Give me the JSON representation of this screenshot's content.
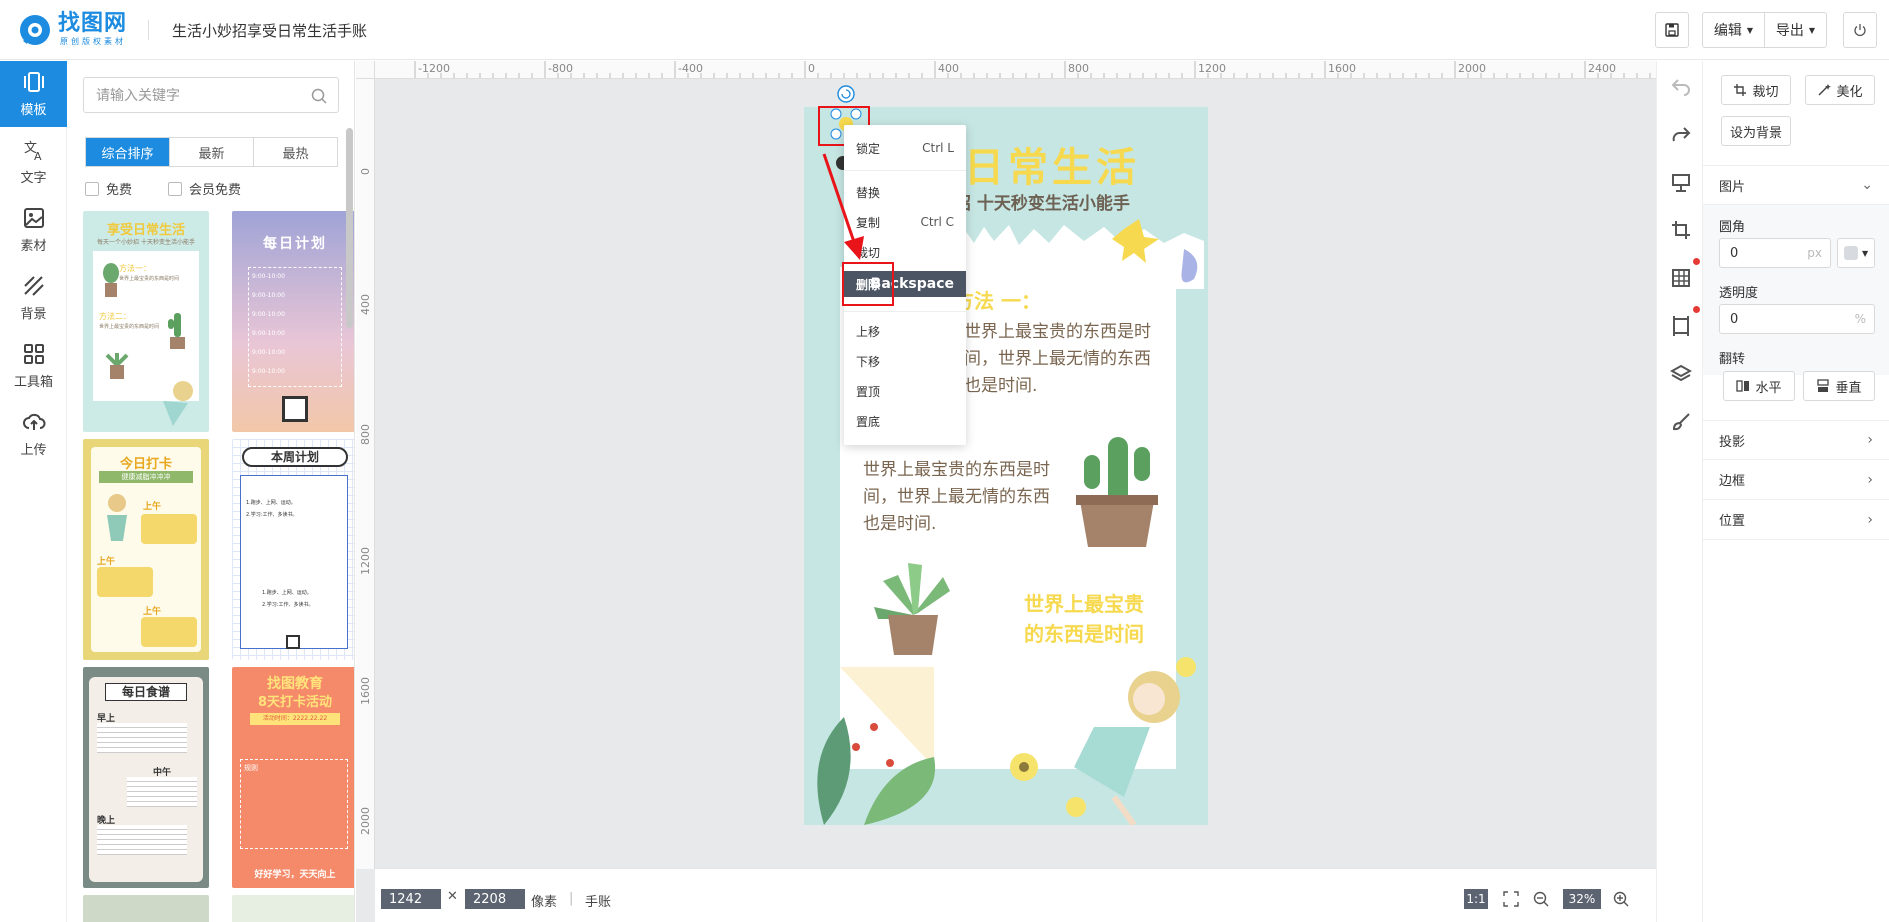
{
  "header": {
    "logo_text": "找图网",
    "logo_sub": "原创版权素材",
    "doc_title": "生活小妙招享受日常生活手账",
    "edit_label": "编辑",
    "export_label": "导出"
  },
  "rail": [
    {
      "label": "模板",
      "icon": "template-icon",
      "active": true
    },
    {
      "label": "文字",
      "icon": "text-icon"
    },
    {
      "label": "素材",
      "icon": "image-icon"
    },
    {
      "label": "背景",
      "icon": "background-icon"
    },
    {
      "label": "工具箱",
      "icon": "toolbox-icon"
    },
    {
      "label": "上传",
      "icon": "upload-icon"
    }
  ],
  "panel": {
    "search_placeholder": "请输入关键字",
    "sort_tabs": [
      "综合排序",
      "最新",
      "最热"
    ],
    "filters": [
      "免费",
      "会员免费"
    ],
    "templates": [
      {
        "title": "享受日常生活",
        "subtitle": "每天一个小妙招 十天秒变生活小能手",
        "lines": [
          "方法一：",
          "世界上最宝贵的东西是时间",
          "方法二：",
          "世界上最宝贵的东西是时间"
        ]
      },
      {
        "title": "每日计划",
        "rows": [
          "9:00-10:00",
          "9:00-10:00",
          "9:00-10:00",
          "9:00-10:00",
          "9:00-10:00",
          "9:00-10:00"
        ]
      },
      {
        "title": "今日打卡",
        "subtitle": "健康减脂冲冲冲",
        "lines": [
          "上午",
          "上午",
          "上午"
        ]
      },
      {
        "title": "本周计划",
        "lines": [
          "1.跑步、上网、运动。",
          "2.学习:工作、多读书。",
          "1.跑步、上网、运动。",
          "2.学习:工作、多读书。"
        ]
      },
      {
        "title": "每日食谱",
        "lines": [
          "早上",
          "中午",
          "晚上"
        ]
      },
      {
        "title": "找图教育",
        "subtitle": "8天打卡活动",
        "date": "活动时间：2222.22.22",
        "lines": [
          "规则"
        ],
        "footer": "好好学习，天天向上"
      }
    ]
  },
  "rulers": {
    "h": [
      "-1200",
      "-800",
      "-400",
      "0",
      "400",
      "800",
      "1200",
      "1600",
      "2000",
      "2400"
    ],
    "v": [
      "0",
      "400",
      "800",
      "1200",
      "1600",
      "2000"
    ]
  },
  "poster": {
    "title": "日常生活",
    "subtitle": "招 十天秒变生活小能手",
    "method1": "方法 一：",
    "para1": [
      "世界上最宝贵的东西是时",
      "间，世界上最无情的东西",
      "也是时间."
    ],
    "para2": [
      "世界上最宝贵的东西是时",
      "间，世界上最无情的东西",
      "也是时间."
    ],
    "quote": [
      "世界上最宝贵",
      "的东西是时间"
    ]
  },
  "context_menu": [
    {
      "label": "锁定",
      "shortcut": "Ctrl L"
    },
    {
      "label": "替换",
      "shortcut": ""
    },
    {
      "label": "复制",
      "shortcut": "Ctrl C"
    },
    {
      "label": "裁切",
      "shortcut": ""
    },
    {
      "label": "删除",
      "shortcut": "Backspace",
      "highlighted": true
    },
    {
      "label": "上移",
      "shortcut": ""
    },
    {
      "label": "下移",
      "shortcut": ""
    },
    {
      "label": "置顶",
      "shortcut": ""
    },
    {
      "label": "置底",
      "shortcut": ""
    }
  ],
  "bottom": {
    "width": "1242",
    "height": "2208",
    "unit": "像素",
    "doc_type": "手账",
    "ratio": "1:1",
    "zoom": "32%"
  },
  "properties": {
    "crop": "裁切",
    "beautify": "美化",
    "set_bg": "设为背景",
    "section_image": "图片",
    "radius_label": "圆角",
    "radius_value": "0",
    "radius_unit": "px",
    "opacity_label": "透明度",
    "opacity_value": "0",
    "opacity_unit": "%",
    "flip_label": "翻转",
    "flip_h": "水平",
    "flip_v": "垂直",
    "shadow": "投影",
    "border": "边框",
    "position": "位置"
  },
  "colors": {
    "accent": "#1d8ce0",
    "highlight_red": "#e8141a",
    "poster_bg": "#c6e6e3",
    "poster_yellow": "#f6d94e"
  }
}
